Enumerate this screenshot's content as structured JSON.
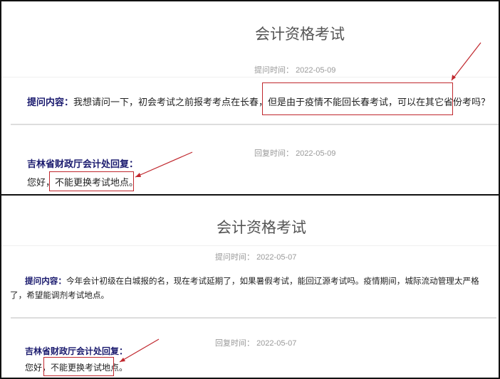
{
  "panels": [
    {
      "title": "会计资格考试",
      "ask_time_label": "提问时间：",
      "ask_time": "2022-05-09",
      "question_label": "提问内容：",
      "question": "我想请问一下，初会考试之前报考考点在长春，但是由于疫情不能回长春考试，可以在其它省份考吗？",
      "reply_time_label": "回复时间：",
      "reply_time": "2022-05-09",
      "reply_label": "吉林省财政厅会计处回复：",
      "reply_greeting": "您好，",
      "reply_text": "不能更换考试地点。"
    },
    {
      "title": "会计资格考试",
      "ask_time_label": "提问时间：",
      "ask_time": "2022-05-07",
      "question_label": "提问内容：",
      "question": "今年会计初级在白城报的名，现在考试延期了，如果暑假考试，能回辽源考试吗。疫情期间，城际流动管理太严格了，希望能调剂考试地点。",
      "reply_time_label": "回复时间：",
      "reply_time": "2022-05-07",
      "reply_label": "吉林省财政厅会计处回复：",
      "reply_greeting": "您好，",
      "reply_text": "不能更换考试地点。"
    }
  ],
  "colors": {
    "highlight": "#c0272d",
    "label": "#1a1a6e"
  }
}
